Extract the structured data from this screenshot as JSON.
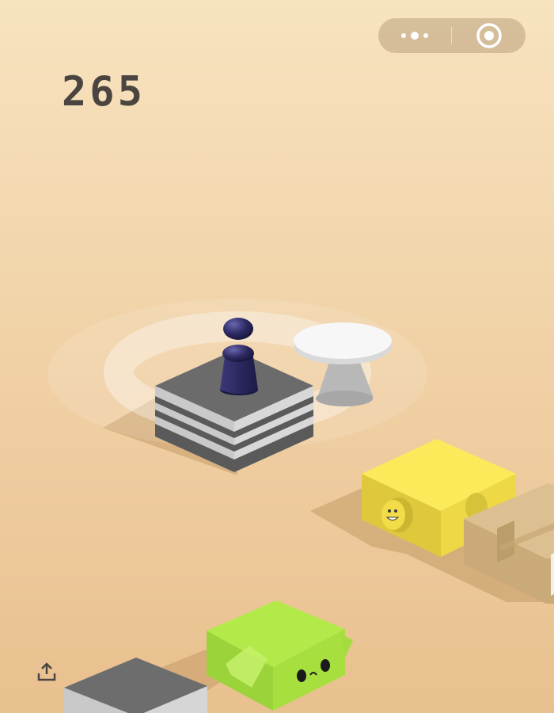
{
  "game": {
    "score": "265"
  },
  "capsule": {
    "more_icon": "more-dots-icon",
    "close_icon": "target-circle-icon"
  },
  "share": {
    "icon": "share-upload-icon"
  },
  "colors": {
    "background_top": "#f7e3bf",
    "background_bottom": "#e9c08f",
    "score_text": "#4a4540",
    "piece": "#2d2a63",
    "yellow_block": "#f5e04d",
    "green_block": "#a4e03f",
    "gray_block": "#5e5e5e",
    "cardboard": "#d6b98c"
  }
}
